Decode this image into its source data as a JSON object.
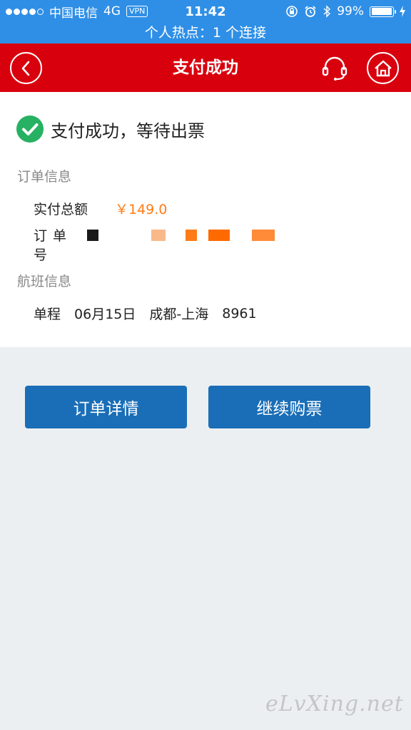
{
  "status_bar": {
    "carrier": "中国电信",
    "network": "4G",
    "vpn": "VPN",
    "time": "11:42",
    "battery": "99%",
    "battery_level": 0.99,
    "hotspot": "个人热点：1 个连接"
  },
  "header": {
    "title": "支付成功",
    "back_icon": "chevron-left-icon",
    "service_icon": "headset-icon",
    "home_icon": "home-icon",
    "background_color": "#d9000d"
  },
  "result": {
    "message": "支付成功，等待出票",
    "icon": "check-circle-icon",
    "icon_color": "#27b162"
  },
  "order_info": {
    "section_title": "订单信息",
    "amount_label": "实付总额",
    "amount_value": "￥149.0",
    "amount_color": "#ff7b16",
    "order_no_label": "订单号"
  },
  "flight_info": {
    "section_title": "航班信息",
    "trip_type": "单程",
    "date": "06月15日",
    "route": "成都-上海",
    "flight_no": "8961"
  },
  "actions": {
    "order_detail": "订单详情",
    "continue_booking": "继续购票",
    "button_color": "#1a6eb7"
  },
  "watermark": "eLvXing.net"
}
